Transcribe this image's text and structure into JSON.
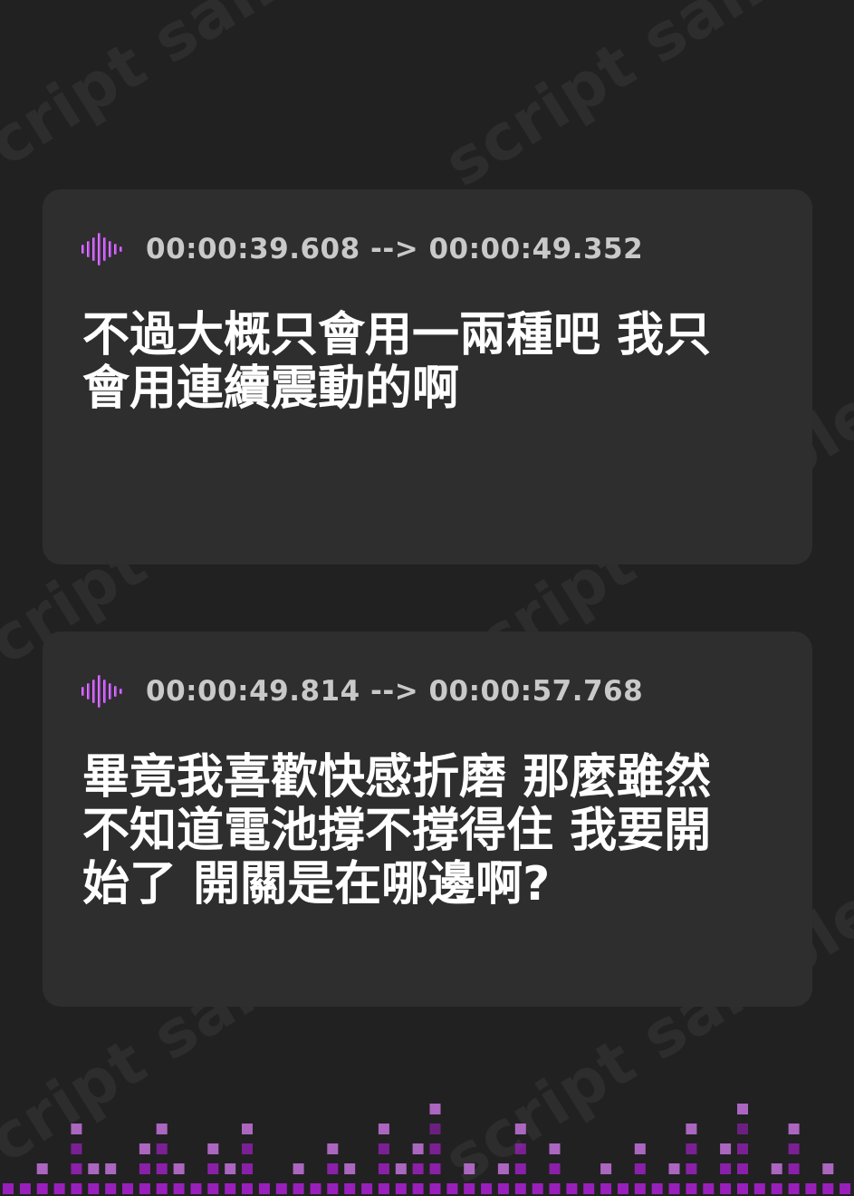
{
  "watermark": {
    "text": "script sample"
  },
  "cards": [
    {
      "icon": "audio-wave-icon",
      "timestamp": "00:00:39.608 --> 00:00:49.352",
      "text": "不過大概只會用一兩種吧 我只\n會用連續震動的啊"
    },
    {
      "icon": "audio-wave-icon",
      "timestamp": "00:00:49.814 --> 00:00:57.768",
      "text": "畢竟我喜歡快感折磨 那麼雖然\n不知道電池撐不撐得住 我要開\n始了 開關是在哪邊啊?"
    }
  ],
  "colors": {
    "background": "#212121",
    "card": "#2e2e2e",
    "accent_light": "#d97ef5",
    "accent_dark": "#a020c4",
    "timestamp": "#c9c9c9"
  },
  "equalizer": {
    "levels": [
      1,
      1,
      2,
      1,
      4,
      2,
      2,
      1,
      3,
      4,
      2,
      1,
      3,
      2,
      4,
      1,
      1,
      2,
      1,
      3,
      2,
      1,
      4,
      2,
      3,
      5,
      1,
      2,
      1,
      2,
      4,
      1,
      3,
      1,
      1,
      2,
      1,
      3,
      1,
      2,
      4,
      1,
      3,
      5,
      1,
      2,
      4,
      1,
      2,
      1
    ]
  }
}
